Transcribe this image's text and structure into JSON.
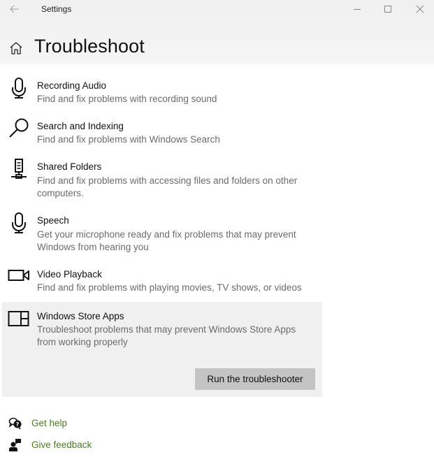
{
  "window": {
    "app_title": "Settings",
    "back_icon": "arrow-left-icon",
    "controls": {
      "minimize": "minimize-icon",
      "maximize": "maximize-icon",
      "close": "close-icon"
    }
  },
  "header": {
    "home_icon": "home-icon",
    "title": "Troubleshoot"
  },
  "troubleshooters": [
    {
      "title": "Recording Audio",
      "description": "Find and fix problems with recording sound",
      "icon": "microphone-icon"
    },
    {
      "title": "Search and Indexing",
      "description": "Find and fix problems with Windows Search",
      "icon": "search-icon"
    },
    {
      "title": "Shared Folders",
      "description": "Find and fix problems with accessing files and folders on other computers.",
      "icon": "network-server-icon"
    },
    {
      "title": "Speech",
      "description": "Get your microphone ready and fix problems that may prevent Windows from hearing you",
      "icon": "microphone-icon"
    },
    {
      "title": "Video Playback",
      "description": "Find and fix problems with playing movies, TV shows, or videos",
      "icon": "video-camera-icon"
    },
    {
      "title": "Windows Store Apps",
      "description": "Troubleshoot problems that may prevent Windows Store Apps from working properly",
      "icon": "store-apps-icon",
      "selected": true,
      "action_label": "Run the troubleshooter"
    }
  ],
  "footer_links": [
    {
      "label": "Get help",
      "icon": "help-chat-icon"
    },
    {
      "label": "Give feedback",
      "icon": "feedback-icon"
    }
  ],
  "colors": {
    "link": "#4c7a28",
    "selected_bg": "#f0f0f0",
    "button_bg": "#c4c4c4",
    "description_text": "#6b6b6b"
  }
}
